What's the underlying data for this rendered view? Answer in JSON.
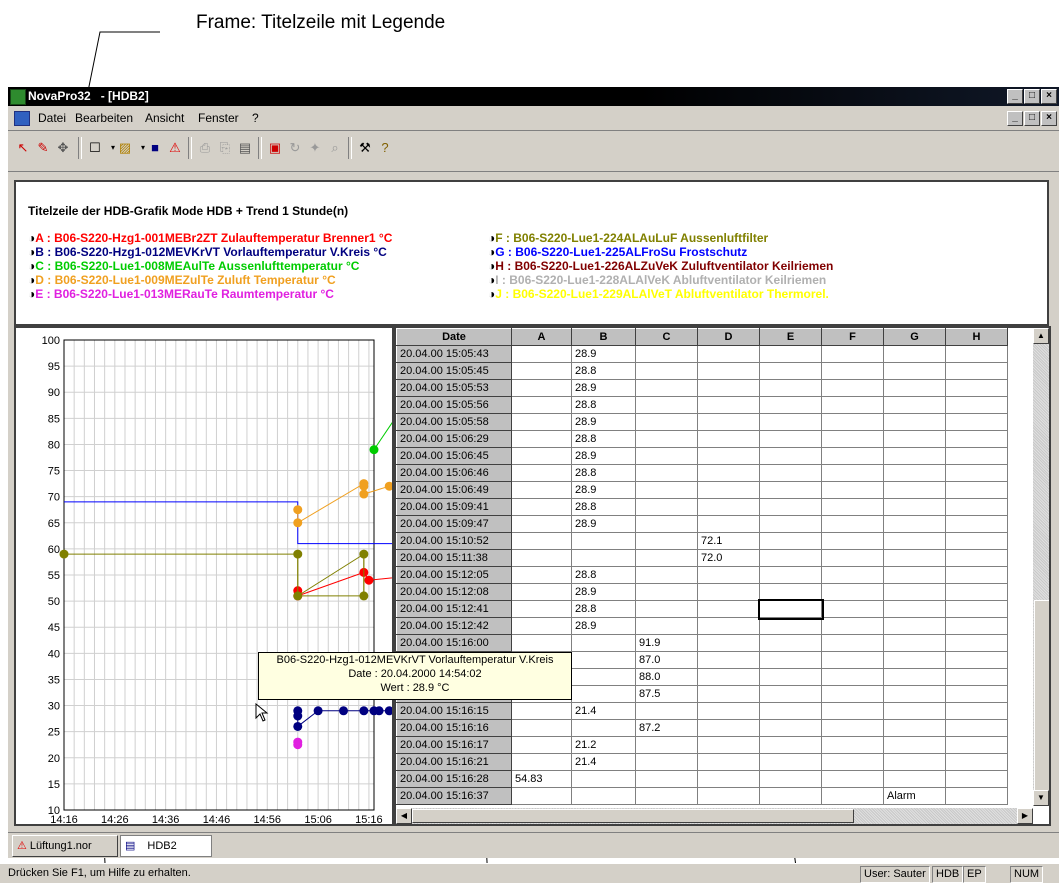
{
  "annotation": {
    "top": "Frame: Titelzeile mit Legende"
  },
  "window": {
    "title": "NovaPro32   - [HDB2]",
    "min": "_",
    "max": "□",
    "close": "×"
  },
  "menu": [
    "Datei",
    "Bearbeiten",
    "Ansicht",
    "Fenster",
    "?"
  ],
  "legend": {
    "title": "Titelzeile der HDB-Grafik  Mode HDB + Trend 1 Stunde(n)",
    "left": [
      {
        "text": "A : B06-S220-Hzg1-001MEBr2ZT Zulauftemperatur Brenner1 °C",
        "color": "#ff0000"
      },
      {
        "text": "B : B06-S220-Hzg1-012MEVKrVT Vorlauftemperatur V.Kreis °C",
        "color": "#000080"
      },
      {
        "text": "C : B06-S220-Lue1-008MEAulTe Aussenlufttemperatur °C",
        "color": "#00cc00"
      },
      {
        "text": "D : B06-S220-Lue1-009MEZulTe Zuluft Temperatur °C",
        "color": "#f0a020"
      },
      {
        "text": "E : B06-S220-Lue1-013MERauTe Raumtemperatur °C",
        "color": "#e020e0"
      }
    ],
    "right": [
      {
        "text": "F : B06-S220-Lue1-224ALAuLuF Aussenluftfilter",
        "color": "#808000"
      },
      {
        "text": "G : B06-S220-Lue1-225ALFroSu Frostschutz",
        "color": "#0000ff"
      },
      {
        "text": "H : B06-S220-Lue1-226ALZuVeK Zuluftventilator Keilriemen",
        "color": "#800000"
      },
      {
        "text": "I : B06-S220-Lue1-228ALAlVeK Abluftventilator Keilriemen",
        "color": "#b0b0b0"
      },
      {
        "text": "J : B06-S220-Lue1-229ALAlVeT Abluftventilator Thermorel.",
        "color": "#ffff00"
      }
    ]
  },
  "chart_data": {
    "type": "line",
    "ylim": [
      10,
      100
    ],
    "y_ticks": [
      "100",
      "95",
      "90",
      "85",
      "80",
      "75",
      "70",
      "65",
      "60",
      "55",
      "50",
      "45",
      "40",
      "35",
      "30",
      "25",
      "20",
      "15",
      "10"
    ],
    "x_ticks": [
      "14:16",
      "14:26",
      "14:36",
      "14:46",
      "14:56",
      "15:06",
      "15:16"
    ],
    "grid": true,
    "series": [
      {
        "name": "A",
        "color": "#ff0000",
        "x": [
          46,
          46,
          59,
          60,
          70
        ],
        "y": [
          52,
          51,
          55.5,
          54,
          55
        ]
      },
      {
        "name": "B",
        "color": "#000080",
        "x": [
          46,
          46,
          46,
          50,
          55,
          59,
          61,
          62,
          64,
          66,
          67,
          70
        ],
        "y": [
          29,
          28,
          26,
          29,
          29,
          29,
          29,
          29,
          29,
          29,
          29,
          21.5
        ]
      },
      {
        "name": "C",
        "color": "#00cc00",
        "x": [
          61,
          70,
          70,
          70
        ],
        "y": [
          79,
          92,
          88,
          87
        ]
      },
      {
        "name": "D",
        "color": "#f0a020",
        "x": [
          46,
          46,
          59,
          59,
          59,
          64,
          66
        ],
        "y": [
          67.5,
          65,
          72.5,
          72,
          70.5,
          72,
          72
        ]
      },
      {
        "name": "E",
        "color": "#e020e0",
        "x": [
          46,
          46
        ],
        "y": [
          23,
          22.5
        ]
      },
      {
        "name": "F",
        "color": "#808000",
        "x": [
          0,
          46,
          46,
          59,
          59
        ],
        "y": [
          59,
          59,
          51,
          59,
          51
        ]
      }
    ]
  },
  "table": {
    "headers": [
      "Date",
      "A",
      "B",
      "C",
      "D",
      "E",
      "F",
      "G",
      "H"
    ],
    "rows": [
      [
        "20.04.00 15:05:43",
        "",
        "28.9",
        "",
        "",
        "",
        "",
        "",
        ""
      ],
      [
        "20.04.00 15:05:45",
        "",
        "28.8",
        "",
        "",
        "",
        "",
        "",
        ""
      ],
      [
        "20.04.00 15:05:53",
        "",
        "28.9",
        "",
        "",
        "",
        "",
        "",
        ""
      ],
      [
        "20.04.00 15:05:56",
        "",
        "28.8",
        "",
        "",
        "",
        "",
        "",
        ""
      ],
      [
        "20.04.00 15:05:58",
        "",
        "28.9",
        "",
        "",
        "",
        "",
        "",
        ""
      ],
      [
        "20.04.00 15:06:29",
        "",
        "28.8",
        "",
        "",
        "",
        "",
        "",
        ""
      ],
      [
        "20.04.00 15:06:45",
        "",
        "28.9",
        "",
        "",
        "",
        "",
        "",
        ""
      ],
      [
        "20.04.00 15:06:46",
        "",
        "28.8",
        "",
        "",
        "",
        "",
        "",
        ""
      ],
      [
        "20.04.00 15:06:49",
        "",
        "28.9",
        "",
        "",
        "",
        "",
        "",
        ""
      ],
      [
        "20.04.00 15:09:41",
        "",
        "28.8",
        "",
        "",
        "",
        "",
        "",
        ""
      ],
      [
        "20.04.00 15:09:47",
        "",
        "28.9",
        "",
        "",
        "",
        "",
        "",
        ""
      ],
      [
        "20.04.00 15:10:52",
        "",
        "",
        "",
        "72.1",
        "",
        "",
        "",
        ""
      ],
      [
        "20.04.00 15:11:38",
        "",
        "",
        "",
        "72.0",
        "",
        "",
        "",
        ""
      ],
      [
        "20.04.00 15:12:05",
        "",
        "28.8",
        "",
        "",
        "",
        "",
        "",
        ""
      ],
      [
        "20.04.00 15:12:08",
        "",
        "28.9",
        "",
        "",
        "",
        "",
        "",
        ""
      ],
      [
        "20.04.00 15:12:41",
        "",
        "28.8",
        "",
        "",
        "",
        "",
        "",
        ""
      ],
      [
        "20.04.00 15:12:42",
        "",
        "28.9",
        "",
        "",
        "",
        "",
        "",
        ""
      ],
      [
        "20.04.00 15:16:00",
        "",
        "",
        "91.9",
        "",
        "",
        "",
        "",
        ""
      ],
      [
        "20.04.00 15:16:01",
        "",
        "",
        "87.0",
        "",
        "",
        "",
        "",
        ""
      ],
      [
        "20.04.00 15:16:02",
        "",
        "",
        "88.0",
        "",
        "",
        "",
        "",
        ""
      ],
      [
        "20.04.00 15:16:10",
        "",
        "",
        "87.5",
        "",
        "",
        "",
        "",
        ""
      ],
      [
        "20.04.00 15:16:15",
        "",
        "21.4",
        "",
        "",
        "",
        "",
        "",
        ""
      ],
      [
        "20.04.00 15:16:16",
        "",
        "",
        "87.2",
        "",
        "",
        "",
        "",
        ""
      ],
      [
        "20.04.00 15:16:17",
        "",
        "21.2",
        "",
        "",
        "",
        "",
        "",
        ""
      ],
      [
        "20.04.00 15:16:21",
        "",
        "21.4",
        "",
        "",
        "",
        "",
        "",
        ""
      ],
      [
        "20.04.00 15:16:28",
        "54.83",
        "",
        "",
        "",
        "",
        "",
        "",
        ""
      ],
      [
        "20.04.00 15:16:37",
        "",
        "",
        "",
        "",
        "",
        "",
        "Alarm",
        ""
      ]
    ]
  },
  "tooltip": {
    "line1": "B06-S220-Hzg1-012MEVKrVT Vorlauftemperatur V.Kreis",
    "line2": "Date : 20.04.2000 14:54:02",
    "line3": "Wert : 28.9 °C"
  },
  "tabs": [
    {
      "label": "Lüftung1.nor"
    },
    {
      "label": "HDB2"
    }
  ],
  "status": {
    "text": "Drücken Sie F1, um Hilfe zu erhalten.",
    "user": "User: Sauter",
    "hdb": "HDB",
    "ep": "EP",
    "num": "NUM"
  },
  "colors": {
    "chrome": "#d4d0c8",
    "title_bar": "#000000",
    "tooltip_bg": "#ffffe1"
  }
}
